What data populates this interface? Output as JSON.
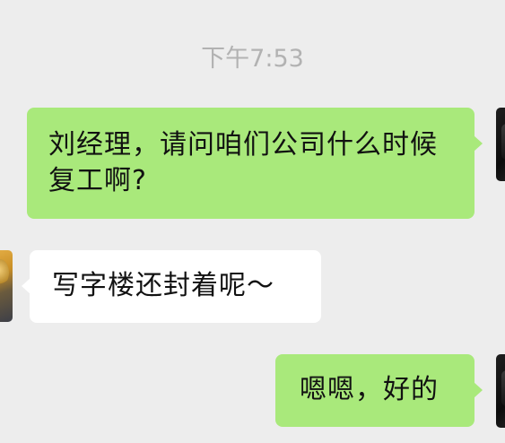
{
  "chat": {
    "timestamp": "下午7:53",
    "messages": [
      {
        "sender": "self",
        "text": "刘经理，请问咱们公司什么时候复工啊?"
      },
      {
        "sender": "other",
        "text": "写字楼还封着呢～"
      },
      {
        "sender": "self",
        "text": "嗯嗯，好的"
      }
    ]
  },
  "colors": {
    "background": "#ededed",
    "sent_bubble": "#a9e97b",
    "received_bubble": "#ffffff",
    "timestamp_text": "#b2b2b2",
    "message_text": "#111111"
  }
}
